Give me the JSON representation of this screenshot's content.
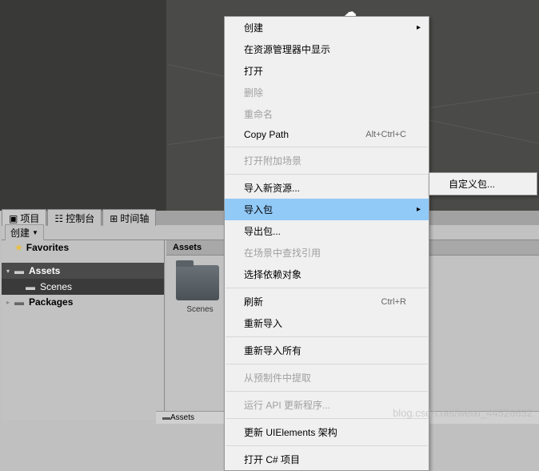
{
  "tabs": {
    "project": "项目",
    "console": "控制台",
    "timeline": "时间轴"
  },
  "toolbar": {
    "create": "创建"
  },
  "tree": {
    "favorites": "Favorites",
    "assets": "Assets",
    "scenes": "Scenes",
    "packages": "Packages"
  },
  "assets": {
    "header": "Assets",
    "folder1": "Scenes",
    "bottom": "Assets"
  },
  "menu": {
    "items": [
      {
        "label": "创建",
        "type": "submenu"
      },
      {
        "label": "在资源管理器中显示"
      },
      {
        "label": "打开"
      },
      {
        "label": "删除",
        "disabled": true
      },
      {
        "label": "重命名",
        "disabled": true
      },
      {
        "label": "Copy Path",
        "shortcut": "Alt+Ctrl+C"
      },
      {
        "type": "sep"
      },
      {
        "label": "打开附加场景",
        "disabled": true
      },
      {
        "type": "sep"
      },
      {
        "label": "导入新资源..."
      },
      {
        "label": "导入包",
        "type": "submenu",
        "highlighted": true
      },
      {
        "label": "导出包..."
      },
      {
        "label": "在场景中查找引用",
        "disabled": true
      },
      {
        "label": "选择依赖对象"
      },
      {
        "type": "sep"
      },
      {
        "label": "刷新",
        "shortcut": "Ctrl+R"
      },
      {
        "label": "重新导入"
      },
      {
        "type": "sep"
      },
      {
        "label": "重新导入所有"
      },
      {
        "type": "sep"
      },
      {
        "label": "从预制件中提取",
        "disabled": true
      },
      {
        "type": "sep"
      },
      {
        "label": "运行 API 更新程序...",
        "disabled": true
      },
      {
        "type": "sep"
      },
      {
        "label": "更新 UIElements 架构"
      },
      {
        "type": "sep"
      },
      {
        "label": "打开 C# 项目"
      }
    ]
  },
  "submenu": {
    "custom": "自定义包..."
  },
  "watermark": "blog.csdn.net/weixi_44526652"
}
